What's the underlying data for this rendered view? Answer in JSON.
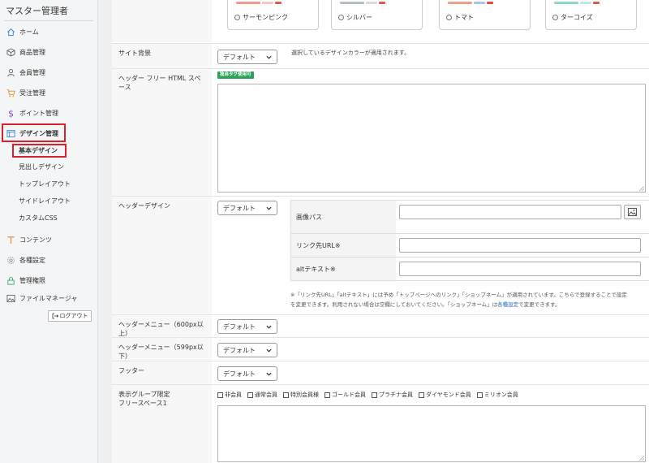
{
  "sidebar": {
    "brand": "マスター管理者",
    "items": [
      {
        "label": "ホーム",
        "icon": "home-icon"
      },
      {
        "label": "商品管理",
        "icon": "box-icon"
      },
      {
        "label": "会員管理",
        "icon": "user-icon"
      },
      {
        "label": "受注管理",
        "icon": "cart-icon"
      },
      {
        "label": "ポイント管理",
        "icon": "dollar-icon"
      },
      {
        "label": "デザイン管理",
        "icon": "layout-icon"
      },
      {
        "label": "コンテンツ",
        "icon": "text-icon"
      },
      {
        "label": "各種設定",
        "icon": "gear-icon"
      },
      {
        "label": "管理権限",
        "icon": "lock-icon"
      },
      {
        "label": "ファイルマネージャ",
        "icon": "image-icon"
      }
    ],
    "subitems": [
      "基本デザイン",
      "見出しデザイン",
      "トップレイアウト",
      "サイドレイアウト",
      "カスタムCSS"
    ],
    "logout": "ログアウト"
  },
  "color_options": [
    "サーモンピンク",
    "シルバー",
    "トマト",
    "ターコイズ"
  ],
  "rows": {
    "site_bg": {
      "label": "サイト背景",
      "select": "デフォルト",
      "hint": "選択しているデザインカラーが適用されます。"
    },
    "header_html": {
      "label": "ヘッダー フリー HTML スペース",
      "badge": "独自タグ使用可"
    },
    "header_design": {
      "label": "ヘッダーデザイン",
      "select": "デフォルト",
      "fields": [
        "画像パス",
        "リンク先URL※",
        "altテキスト※"
      ],
      "note_1": "※「リンク先URL」「altテキスト」には予め「トップページへのリンク」「ショップネーム」が適用されています。こちらで登録することで設定",
      "note_2a": "を変更できます。利用されない場合は空欄にしておいてください。「ショップネーム」は",
      "note_link": "各種設定",
      "note_2b": "で変更できます。"
    },
    "header_menu_600": {
      "label": "ヘッダーメニュー（600px以上）",
      "select": "デフォルト"
    },
    "header_menu_599": {
      "label": "ヘッダーメニュー（599px以下）",
      "select": "デフォルト"
    },
    "footer": {
      "label": "フッター",
      "select": "デフォルト"
    },
    "group_space": {
      "label_1": "表示グループ限定",
      "label_2": "フリースペース1",
      "groups": [
        "非会員",
        "通常会員",
        "特別会員様",
        "ゴールド会員",
        "プラチナ会員",
        "ダイヤモンド会員",
        "ミリオン会員"
      ]
    }
  },
  "colors": {
    "highlight": "#d9222a",
    "badge": "#2da05a",
    "link": "#2a6bbf"
  }
}
